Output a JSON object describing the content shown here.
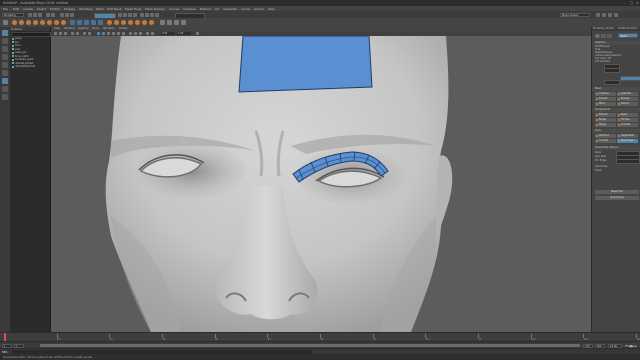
{
  "title_bar": {
    "title": "Untitled* - Autodesk Maya 2018: untitled",
    "window_buttons": [
      "–",
      "□",
      "×"
    ]
  },
  "menu_bar": {
    "items": [
      "File",
      "Edit",
      "Create",
      "Select",
      "Modify",
      "Display",
      "Windows",
      "Mesh",
      "Edit Mesh",
      "Mesh Tools",
      "Mesh Display",
      "Curves",
      "Surfaces",
      "Deform",
      "UV",
      "Generate",
      "Cache",
      "Arnold",
      "Help"
    ]
  },
  "status_line": {
    "menu_set": "Modeling",
    "workspace": "Maya Classic"
  },
  "outliner": {
    "header": "Outliner",
    "items": [
      "persp",
      "top",
      "front",
      "side",
      "head_geo",
      "brow_patch",
      "forehead_patch",
      "defaultLightSet",
      "defaultObjectSet"
    ]
  },
  "viewport": {
    "menu": [
      "View",
      "Shading",
      "Lighting",
      "Show",
      "Renderer",
      "Panels"
    ],
    "camera": "persp",
    "field_value": "0.00",
    "scale_value": "1.00",
    "colors": {
      "background": "#5c5c5c",
      "skin": "#cfcfcf",
      "skin_shadow": "#9a9a9a",
      "selection": "#5a8fd1",
      "wire": "#1f3e66"
    }
  },
  "right_panel": {
    "tabs": [
      "Modeling Toolkit",
      "Attribute Editor"
    ],
    "mode_label": "Object",
    "sections": {
      "selection": "Selection",
      "mesh": "Mesh",
      "components": "Components",
      "tools": "Tools",
      "quad_draw": "Quad Draw Options"
    },
    "selection_rows": [
      "Pick/Marquee",
      "Drag",
      "Tweak/Marquee",
      "Camera-based Selection",
      "Symmetry: Off",
      "Soft Selection"
    ],
    "mesh_buttons": [
      "Combine",
      "Separate",
      "Smooth",
      "Boolean",
      "Mirror",
      "Extract"
    ],
    "component_buttons": [
      "Extrude",
      "Bevel",
      "Bridge",
      "Fill Hole",
      "Merge",
      "Chamfer"
    ],
    "tool_buttons": [
      "Multi-Cut",
      "Target Weld",
      "Connect",
      "Quad Draw"
    ],
    "options": [
      "Relax",
      "Auto Weld",
      "Ext. Edges"
    ],
    "quad_draw_rows": [
      "Quad Draw",
      "Tweak"
    ],
    "full_buttons": [
      "Reset Tool",
      "Quad Draw"
    ]
  },
  "timeslider": {
    "labels": [
      "1",
      "10",
      "20",
      "30",
      "40",
      "50",
      "60",
      "70",
      "80",
      "90",
      "100",
      "110",
      "120"
    ],
    "current_frame": "1"
  },
  "range_slider": {
    "start": "1",
    "end": "120",
    "anim_end": "200",
    "fps": "24 fps"
  },
  "play_controls": [
    "⏮",
    "◀",
    "▶",
    "⏭"
  ],
  "command_line": {
    "language": "MEL"
  },
  "help_line": {
    "text": "Quad Draw Tool: Click to place dots; Shift+click to create quads"
  }
}
